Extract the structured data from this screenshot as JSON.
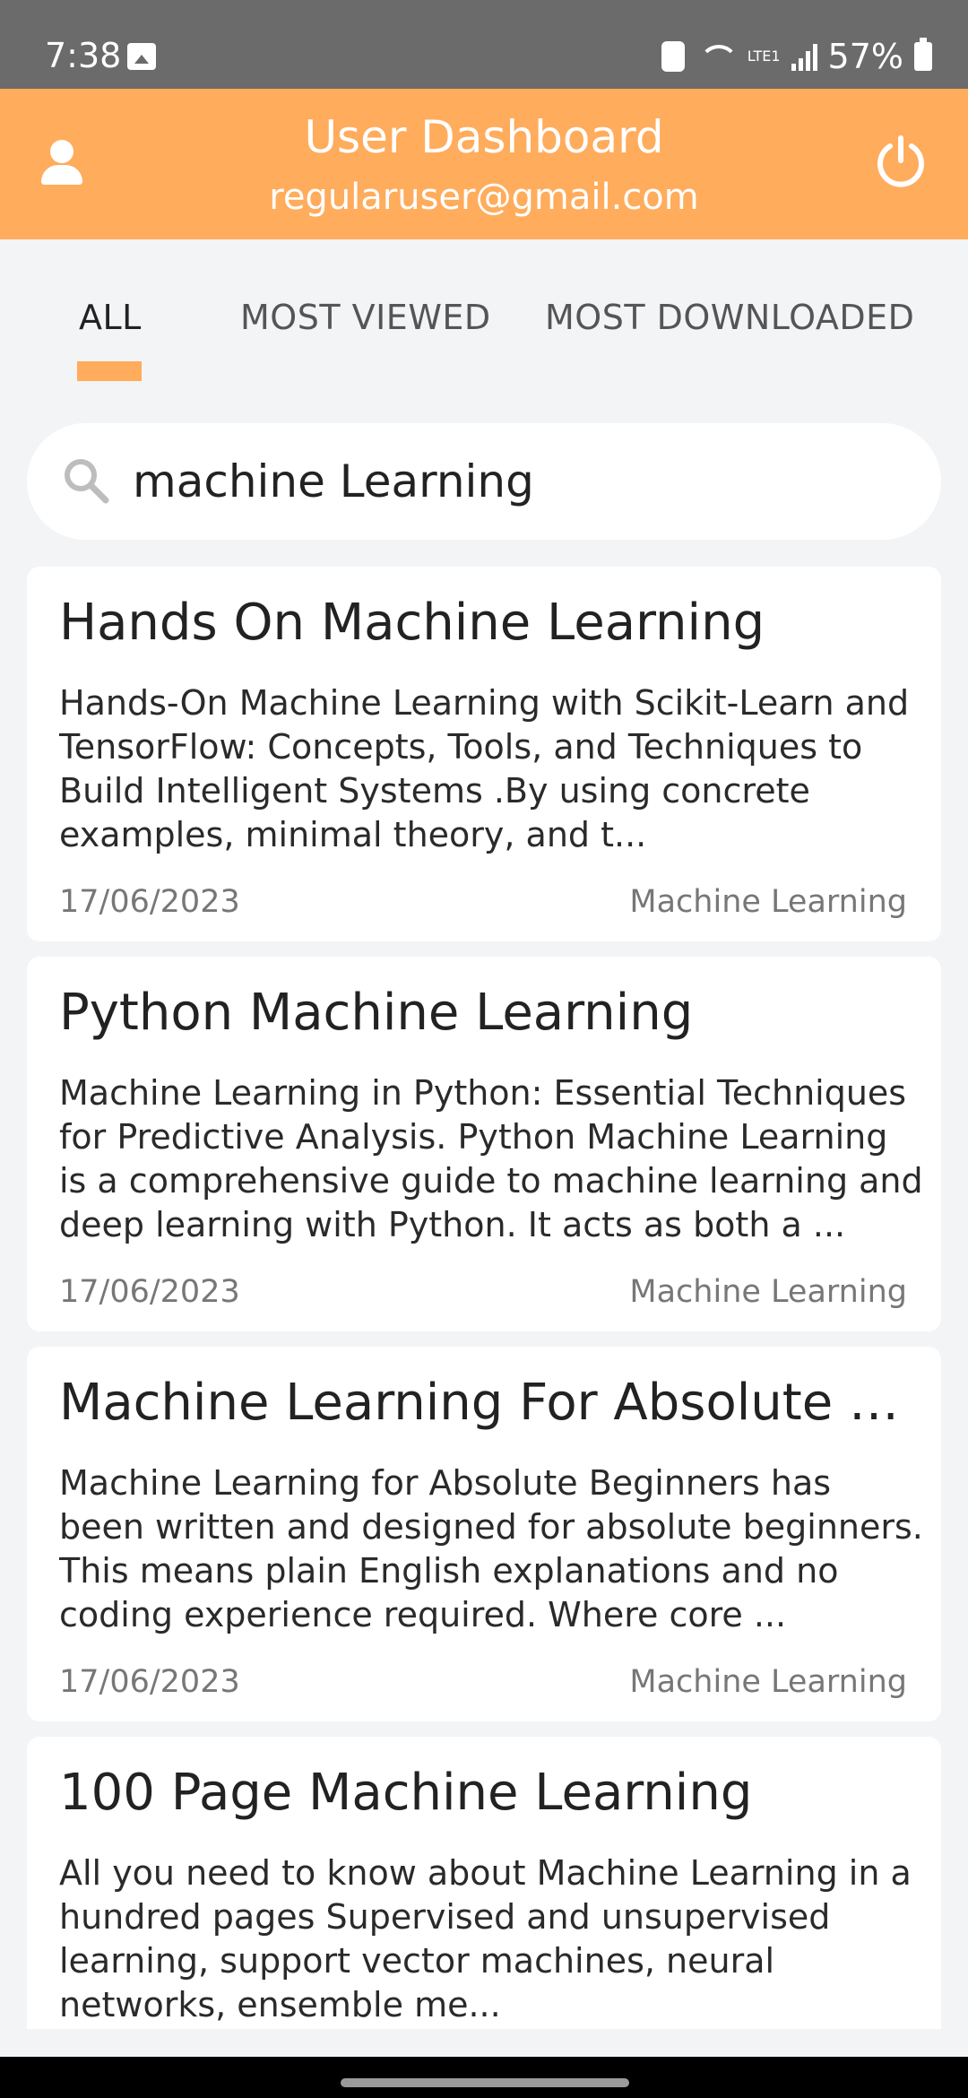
{
  "status_bar": {
    "time": "7:38",
    "battery": "57%",
    "network_label": "LTE1"
  },
  "header": {
    "title": "User Dashboard",
    "email": "regularuser@gmail.com"
  },
  "tabs": [
    {
      "label": "ALL",
      "active": true
    },
    {
      "label": "MOST VIEWED",
      "active": false
    },
    {
      "label": "MOST DOWNLOADED",
      "active": false
    }
  ],
  "search": {
    "value": "machine Learning"
  },
  "books": [
    {
      "title": "Hands On Machine Learning",
      "description": "Hands-On Machine Learning with Scikit-Learn and TensorFlow: Concepts, Tools, and Techniques to Build Intelligent Systems .By using concrete examples, minimal theory, and t...",
      "date": "17/06/2023",
      "category": "Machine Learning"
    },
    {
      "title": "Python Machine Learning",
      "description": "Machine Learning in Python: Essential Techniques for Predictive Analysis. Python Machine Learning is a comprehensive guide to machine learning and deep learning with Python. It acts as both a ...",
      "date": "17/06/2023",
      "category": "Machine Learning"
    },
    {
      "title": "Machine Learning For Absolute B...",
      "description": "Machine Learning for Absolute Beginners has been written and designed for absolute beginners. This means plain English explanations and no coding experience required. Where core ...",
      "date": "17/06/2023",
      "category": "Machine Learning"
    },
    {
      "title": "100 Page Machine Learning",
      "description": "All you need to know about Machine Learning in a hundred pages Supervised and unsupervised learning, support vector machines, neural networks, ensemble me...",
      "date": "",
      "category": ""
    }
  ],
  "colors": {
    "accent": "#ffac5c",
    "status_bar": "#6b6b6b",
    "background": "#f3f4f6"
  }
}
